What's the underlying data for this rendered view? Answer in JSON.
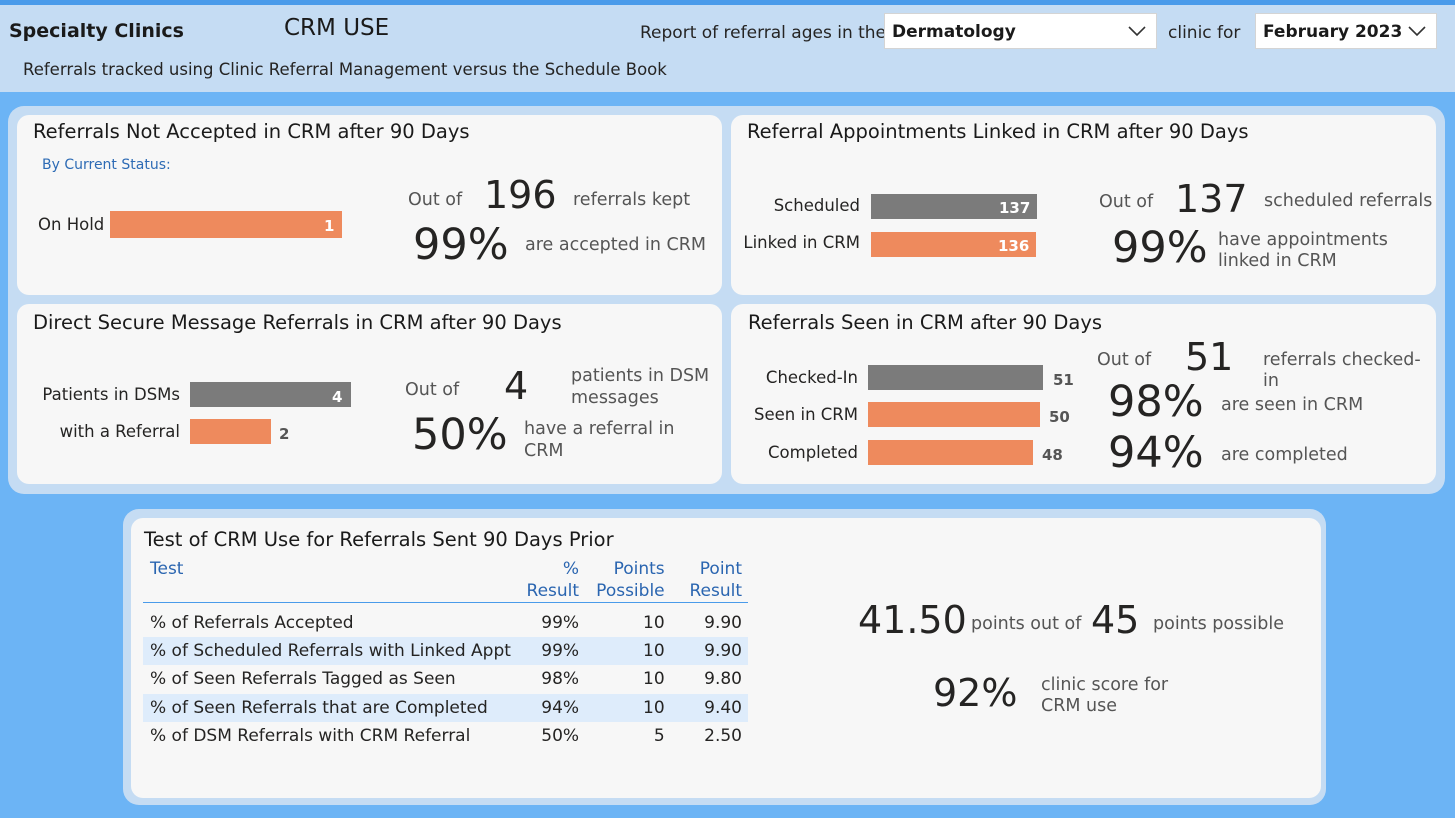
{
  "header": {
    "brand": "Specialty Clinics",
    "title": "CRM USE",
    "subtitle": "Referrals tracked using Clinic Referral Management versus the Schedule Book",
    "filter_prefix": "Report of referral ages in the",
    "clinic_value": "Dermatology",
    "filter_mid": "clinic for",
    "month_value": "February 2023"
  },
  "not_accepted": {
    "title": "Referrals Not Accepted in CRM after 90 Days",
    "status_header": "By Current Status:",
    "bar_label": "On Hold",
    "bar_value": "1",
    "out_of": "Out of",
    "total": "196",
    "total_suffix": "referrals kept",
    "pct": "99%",
    "pct_text": "are accepted in CRM"
  },
  "linked": {
    "title": "Referral Appointments Linked in CRM after 90 Days",
    "bar1_label": "Scheduled",
    "bar1_value": "137",
    "bar2_label": "Linked in CRM",
    "bar2_value": "136",
    "out_of": "Out of",
    "total": "137",
    "total_suffix": "scheduled referrals",
    "pct": "99%",
    "pct_text_1": "have appointments",
    "pct_text_2": "linked in CRM"
  },
  "dsm": {
    "title": "Direct Secure Message Referrals in CRM after 90 Days",
    "bar1_label": "Patients in DSMs",
    "bar1_value": "4",
    "bar2_label": "with a Referral",
    "bar2_value": "2",
    "out_of": "Out of",
    "total": "4",
    "total_text_1": "patients in DSM",
    "total_text_2": "messages",
    "pct": "50%",
    "pct_text_1": "have a referral in",
    "pct_text_2": "CRM"
  },
  "seen": {
    "title": "Referrals Seen in CRM after 90 Days",
    "bar1_label": "Checked-In",
    "bar1_value": "51",
    "bar2_label": "Seen in CRM",
    "bar2_value": "50",
    "bar3_label": "Completed",
    "bar3_value": "48",
    "out_of": "Out of",
    "total": "51",
    "total_suffix": "referrals checked-in",
    "pct1": "98%",
    "pct1_text": "are seen in CRM",
    "pct2": "94%",
    "pct2_text": "are completed"
  },
  "test": {
    "title": "Test of CRM Use for Referrals Sent 90 Days Prior",
    "columns": {
      "test": "Test",
      "result_1": "%",
      "result_2": "Result",
      "possible_1": "Points",
      "possible_2": "Possible",
      "point_1": "Point",
      "point_2": "Result"
    },
    "rows": [
      {
        "test": "% of Referrals Accepted",
        "result": "99%",
        "possible": "10",
        "point": "9.90"
      },
      {
        "test": "% of Scheduled Referrals with Linked Appt",
        "result": "99%",
        "possible": "10",
        "point": "9.90"
      },
      {
        "test": "% of Seen Referrals Tagged as Seen",
        "result": "98%",
        "possible": "10",
        "point": "9.80"
      },
      {
        "test": "% of Seen Referrals that are Completed",
        "result": "94%",
        "possible": "10",
        "point": "9.40"
      },
      {
        "test": "% of DSM Referrals with CRM Referral",
        "result": "50%",
        "possible": "5",
        "point": "2.50"
      }
    ],
    "points": "41.50",
    "points_text": "points out of",
    "possible": "45",
    "possible_text": "points possible",
    "score": "92%",
    "score_text_1": "clinic score for",
    "score_text_2": "CRM use"
  },
  "colors": {
    "background": "#6cb4f5",
    "header": "#c5dcf3",
    "bar_gray": "#7b7b7b",
    "bar_orange": "#ee8a5d",
    "table_header_text": "#2a65b0",
    "table_alt_row": "#deecfb"
  }
}
